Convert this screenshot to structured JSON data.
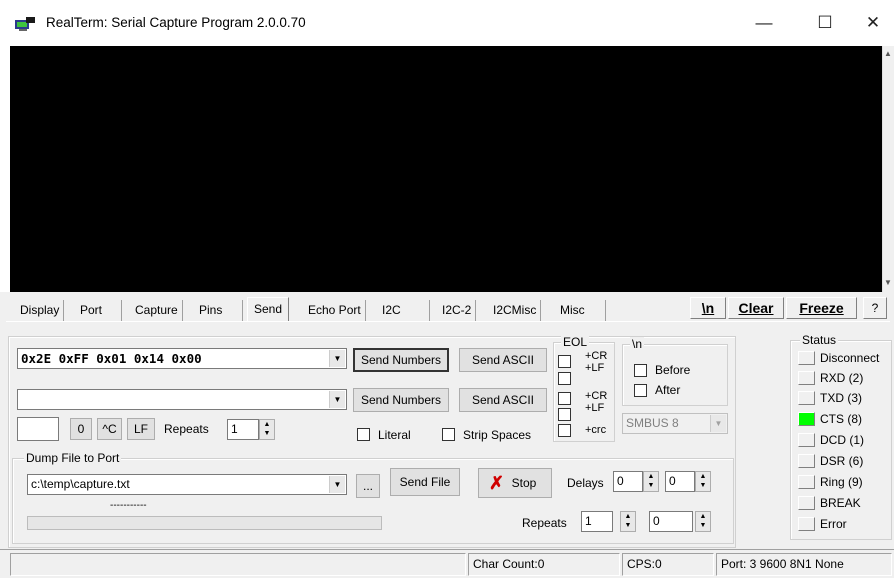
{
  "window": {
    "title": "RealTerm: Serial Capture Program 2.0.0.70",
    "minimize": "—",
    "maximize": "☐",
    "close": "✕"
  },
  "tabs": [
    "Display",
    "Port",
    "Capture",
    "Pins",
    "Send",
    "Echo Port",
    "I2C",
    "I2C-2",
    "I2CMisc",
    "Misc"
  ],
  "active_tab": "Send",
  "toolbar": {
    "newline": "\\n",
    "clear": "Clear",
    "freeze": "Freeze",
    "help": "?"
  },
  "send": {
    "line1_value": "0x2E 0xFF 0x01 0x14 0x00",
    "line2_value": "",
    "send_numbers_1": "Send Numbers",
    "send_ascii_1": "Send ASCII",
    "send_numbers_2": "Send Numbers",
    "send_ascii_2": "Send ASCII",
    "zero_btn": "0",
    "ctrl_c_btn": "^C",
    "lf_btn": "LF",
    "repeats_label": "Repeats",
    "repeats_value": "1",
    "literal_label": "Literal",
    "strip_spaces_label": "Strip Spaces"
  },
  "eol": {
    "title": "EOL",
    "cr1": "+CR",
    "lf1": "+LF",
    "cr2": "+CR",
    "lf2": "+LF",
    "crc": "+crc"
  },
  "nl_group": {
    "title": "\\n",
    "before": "Before",
    "after": "After",
    "smbus": "SMBUS 8"
  },
  "dump": {
    "title": "Dump File to Port",
    "path": "c:\\temp\\capture.txt",
    "browse": "...",
    "send_file": "Send File",
    "stop": "Stop",
    "delays_label": "Delays",
    "delay1": "0",
    "delay2": "0",
    "repeats_label": "Repeats",
    "repeats1": "1",
    "repeats2": "0",
    "progress_text": "-----------"
  },
  "status": {
    "title": "Status",
    "items": [
      {
        "label": "Disconnect",
        "on": false
      },
      {
        "label": "RXD (2)",
        "on": false
      },
      {
        "label": "TXD (3)",
        "on": false
      },
      {
        "label": "CTS (8)",
        "on": true
      },
      {
        "label": "DCD (1)",
        "on": false
      },
      {
        "label": "DSR (6)",
        "on": false
      },
      {
        "label": "Ring (9)",
        "on": false
      },
      {
        "label": "BREAK",
        "on": false
      },
      {
        "label": "Error",
        "on": false
      }
    ],
    "led_on_color": "#00ff00"
  },
  "statusbar": {
    "char_count": "Char Count:0",
    "cps": "CPS:0",
    "port": "Port: 3 9600 8N1 None"
  }
}
